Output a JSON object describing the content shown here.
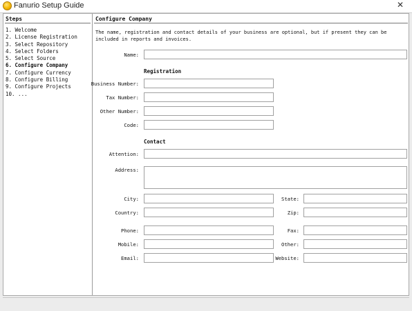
{
  "window": {
    "title": "Fanurio Setup Guide",
    "close_glyph": "✕",
    "icon": "fanurio-app-icon"
  },
  "steps": {
    "header": "Steps",
    "items": [
      "1. Welcome",
      "2. License Registration",
      "3. Select Repository",
      "4. Select Folders",
      "5. Select Source",
      "6. Configure Company",
      "7. Configure Currency",
      "8. Configure Billing",
      "9. Configure Projects",
      "10. ..."
    ],
    "active_index": 5
  },
  "main": {
    "header": "Configure Company",
    "intro": "The name, registration and contact details of your business are optional, but if present they can be included in reports and invoices.",
    "name_label": "Name:",
    "registration_heading": "Registration",
    "registration": {
      "business_number": "Business Number:",
      "tax_number": "Tax Number:",
      "other_number": "Other Number:",
      "code": "Code:"
    },
    "contact_heading": "Contact",
    "contact": {
      "attention": "Attention:",
      "address": "Address:",
      "city": "City:",
      "state": "State:",
      "country": "Country:",
      "zip": "Zip:",
      "phone": "Phone:",
      "fax": "Fax:",
      "mobile": "Mobile:",
      "other": "Other:",
      "email": "Email:",
      "website": "Website:"
    }
  }
}
